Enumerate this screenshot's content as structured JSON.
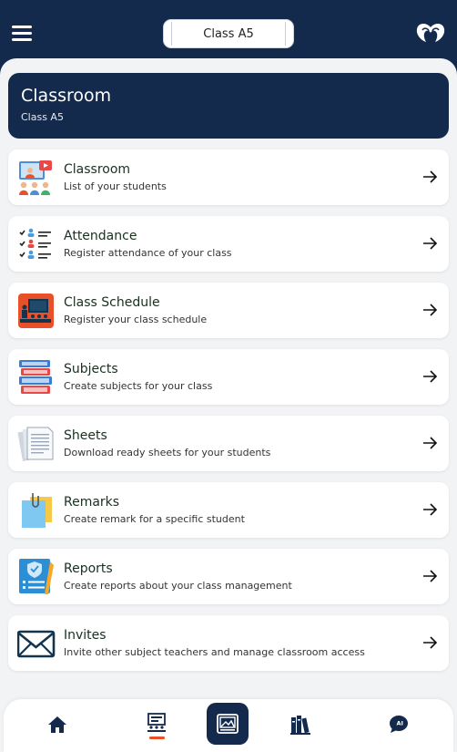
{
  "header": {
    "class_selector": "Class A5"
  },
  "hero": {
    "title": "Classroom",
    "subtitle": "Class A5"
  },
  "menu": [
    {
      "label": "Classroom",
      "desc": "List of your students",
      "icon": "classroom-icon"
    },
    {
      "label": "Attendance",
      "desc": "Register attendance of your class",
      "icon": "attendance-icon"
    },
    {
      "label": "Class Schedule",
      "desc": "Register your class schedule",
      "icon": "schedule-icon"
    },
    {
      "label": "Subjects",
      "desc": "Create subjects for your class",
      "icon": "subjects-icon"
    },
    {
      "label": "Sheets",
      "desc": "Download ready sheets for your students",
      "icon": "sheets-icon"
    },
    {
      "label": "Remarks",
      "desc": "Create remark for a specific student",
      "icon": "remarks-icon"
    },
    {
      "label": "Reports",
      "desc": "Create reports about your class management",
      "icon": "reports-icon"
    },
    {
      "label": "Invites",
      "desc": "Invite other subject teachers and manage classroom access",
      "icon": "invites-icon"
    }
  ],
  "colors": {
    "navy": "#142a4c",
    "accent": "#e8502a",
    "background": "#f2f3f5"
  }
}
